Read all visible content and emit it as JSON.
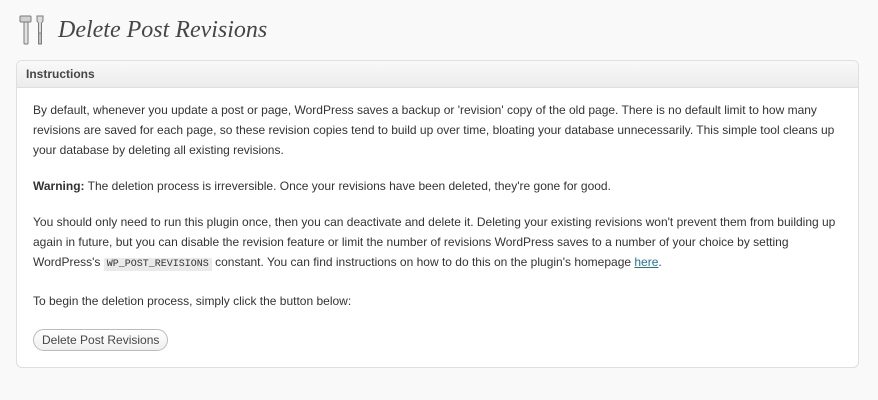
{
  "page": {
    "title": "Delete Post Revisions",
    "icon": "tools-icon"
  },
  "instructions": {
    "header": "Instructions",
    "paragraph1": "By default, whenever you update a post or page, WordPress saves a backup or 'revision' copy of the old page. There is no default limit to how many revisions are saved for each page, so these revision copies tend to build up over time, bloating your database unnecessarily. This simple tool cleans up your database by deleting all existing revisions.",
    "warning_label": "Warning:",
    "warning_text": " The deletion process is irreversible. Once your revisions have been deleted, they're gone for good.",
    "paragraph3_before": "You should only need to run this plugin once, then you can deactivate and delete it. Deleting your existing revisions won't prevent them from building up again in future, but you can disable the revision feature or limit the number of revisions WordPress saves to a number of your choice by setting WordPress's ",
    "constant_code": "WP_POST_REVISIONS",
    "paragraph3_after": " constant. You can find instructions on how to do this on the plugin's homepage ",
    "link_text": "here",
    "paragraph3_end": ".",
    "paragraph4": "To begin the deletion process, simply click the button below:",
    "button_label": "Delete Post Revisions"
  },
  "colors": {
    "background": "#f9f9f9",
    "link": "#21759b",
    "title": "#464646"
  }
}
